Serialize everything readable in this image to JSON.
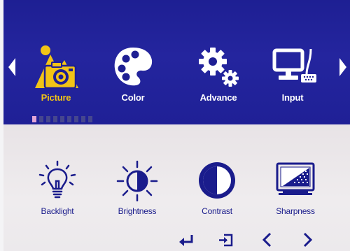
{
  "main_menu": {
    "items": [
      {
        "label": "Picture",
        "icon": "picture-icon",
        "selected": true
      },
      {
        "label": "Color",
        "icon": "palette-icon",
        "selected": false
      },
      {
        "label": "Advance",
        "icon": "gears-icon",
        "selected": false
      },
      {
        "label": "Input",
        "icon": "monitor-input-icon",
        "selected": false
      }
    ],
    "left_arrow_icon": "triangle-left-icon",
    "right_arrow_icon": "triangle-right-icon"
  },
  "page_indicator": {
    "total": 9,
    "current": 1
  },
  "submenu": {
    "items": [
      {
        "label": "Backlight",
        "icon": "bulb-icon"
      },
      {
        "label": "Brightness",
        "icon": "sun-icon"
      },
      {
        "label": "Contrast",
        "icon": "contrast-icon"
      },
      {
        "label": "Sharpness",
        "icon": "sharpness-icon"
      }
    ]
  },
  "nav_buttons": [
    "enter-icon",
    "exit-icon",
    "chevron-left-icon",
    "chevron-right-icon"
  ],
  "colors": {
    "top_background": "#22239c",
    "bottom_background": "#ebe7ea",
    "selected_accent": "#f2c416",
    "label_text": "#1a1c8c",
    "inactive_icon": "#ffffff",
    "active_dot": "#e3a6d6"
  }
}
